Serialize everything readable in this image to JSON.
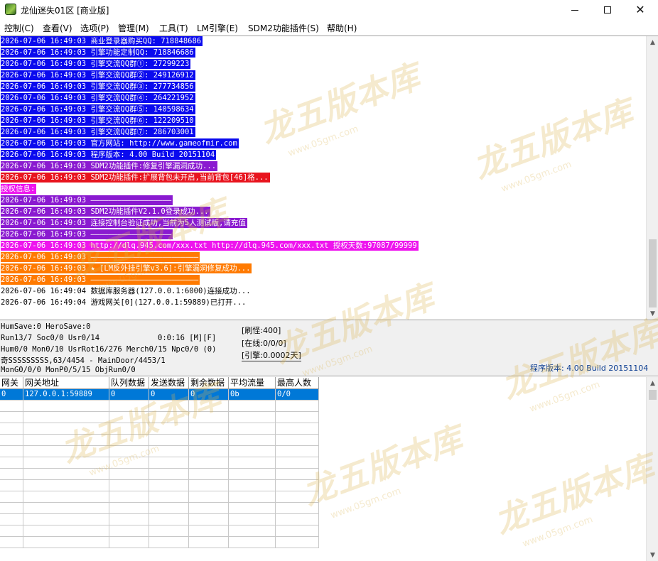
{
  "window": {
    "title": "龙仙迷失01区 [商业版]",
    "icon": "game-app-icon",
    "minimize_glyph": "",
    "close_glyph": "✕"
  },
  "menu": [
    "控制(C)",
    "查看(V)",
    "选项(P)",
    "管理(M)",
    "工具(T)",
    "LM引擎(E)",
    "SDM2功能插件(S)",
    "帮助(H)"
  ],
  "log": {
    "lines": [
      {
        "time": "2026-07-06 16:49:03",
        "text": "商业登录器购买QQ: 718848686",
        "bg": "#0a0aee",
        "fg": "#ffffff"
      },
      {
        "time": "2026-07-06 16:49:03",
        "text": "引擎功能定制QQ: 718846686",
        "bg": "#0a0aee",
        "fg": "#ffffff"
      },
      {
        "time": "2026-07-06 16:49:03",
        "text": "引擎交流QQ群①: 27299223",
        "bg": "#0a0aee",
        "fg": "#ffffff"
      },
      {
        "time": "2026-07-06 16:49:03",
        "text": "引擎交流QQ群②: 249126912",
        "bg": "#0a0aee",
        "fg": "#ffffff"
      },
      {
        "time": "2026-07-06 16:49:03",
        "text": "引擎交流QQ群③: 277734856",
        "bg": "#0a0aee",
        "fg": "#ffffff"
      },
      {
        "time": "2026-07-06 16:49:03",
        "text": "引擎交流QQ群④: 264221952",
        "bg": "#0a0aee",
        "fg": "#ffffff"
      },
      {
        "time": "2026-07-06 16:49:03",
        "text": "引擎交流QQ群⑤: 140598634",
        "bg": "#0a0aee",
        "fg": "#ffffff"
      },
      {
        "time": "2026-07-06 16:49:03",
        "text": "引擎交流QQ群⑥: 122209510",
        "bg": "#0a0aee",
        "fg": "#ffffff"
      },
      {
        "time": "2026-07-06 16:49:03",
        "text": "引擎交流QQ群⑦: 286703001",
        "bg": "#0a0aee",
        "fg": "#ffffff"
      },
      {
        "time": "2026-07-06 16:49:03",
        "text": "官方网站: http://www.gameofmir.com",
        "bg": "#0a0aee",
        "fg": "#ffffff"
      },
      {
        "time": "2026-07-06 16:49:03",
        "text": "程序版本: 4.00 Build 20151104",
        "bg": "#0a0aee",
        "fg": "#ffffff"
      },
      {
        "time": "2026-07-06 16:49:03",
        "text": "SDM2功能插件:修复引擎漏洞成功...",
        "bg": "#8a1ad0",
        "fg": "#ffffff"
      },
      {
        "time": "2026-07-06 16:49:03",
        "text": "SDM2功能插件:扩展背包未开启,当前背包[46]格...",
        "bg": "#e8141e",
        "fg": "#ffffff"
      },
      {
        "time": "",
        "text": "授权信息:",
        "bg": "#ee14ee",
        "fg": "#ffffff"
      },
      {
        "time": "2026-07-06 16:49:03",
        "text": "——————————————————",
        "bg": "#8a1ad0",
        "fg": "#ffffff"
      },
      {
        "time": "2026-07-06 16:49:03",
        "text": "SDM2功能插件V2.1.0登录成功...",
        "bg": "#8a1ad0",
        "fg": "#ffffff"
      },
      {
        "time": "2026-07-06 16:49:03",
        "text": "连接控制台验证成功,当前为5人测试版,请充值",
        "bg": "#8a1ad0",
        "fg": "#ffffff"
      },
      {
        "time": "2026-07-06 16:49:03",
        "text": "——————————————————",
        "bg": "#8a1ad0",
        "fg": "#ffffff"
      },
      {
        "time": "2026-07-06 16:49:03",
        "text": "http://dlq.945.com/xxx.txt http://dlq.945.com/xxx.txt 授权天数:97087/99999",
        "bg": "#ee14ee",
        "fg": "#ffffff"
      },
      {
        "time": "2026-07-06 16:49:03",
        "text": "————————————————————————",
        "bg": "#ff7a00",
        "fg": "#ffffff"
      },
      {
        "time": "2026-07-06 16:49:03",
        "text": "★ [LM反外挂引擎v3.6]:引擎漏洞修复成功...",
        "bg": "#ff7a00",
        "fg": "#ffffff"
      },
      {
        "time": "2026-07-06 16:49:03",
        "text": "————————————————————————",
        "bg": "#ff7a00",
        "fg": "#ffffff"
      },
      {
        "time": "2026-07-06 16:49:04",
        "text": "数据库服务器(127.0.0.1:6000)连接成功...",
        "bg": "#ffffff",
        "fg": "#000000"
      },
      {
        "time": "2026-07-06 16:49:04",
        "text": "游戏网关[0](127.0.0.1:59889)已打开...",
        "bg": "#ffffff",
        "fg": "#000000"
      }
    ]
  },
  "status": {
    "line1": "HumSave:0 HeroSave:0",
    "line2": "Run13/7 Soc0/0 Usr0/14",
    "timer": "0:0:16 [M][F]",
    "line3": "Hum0/0 Mon0/10 UsrRot16/276 Merch0/15 Npc0/0 (0)",
    "line4": "奇SSSSSSSSS,63/4454 - MainDoor/4453/1",
    "line5": "MonG0/0/0 MonP0/5/15 ObjRun0/0",
    "refresh": "[刷怪:400]",
    "online": "[在线:0/0/0]",
    "engine": "[引擎:0.0002天]",
    "version": "程序版本: 4.00 Build 20151104"
  },
  "grid": {
    "headers": [
      "网关",
      "网关地址",
      "队列数据",
      "发送数据",
      "剩余数据",
      "平均流量",
      "最高人数"
    ],
    "rows": [
      [
        "0",
        "127.0.0.1:59889",
        "0",
        "0",
        "0",
        "0b",
        "0/0"
      ]
    ],
    "selection_color": "#0078d7"
  },
  "watermark": {
    "text": "龙五版本库",
    "sub": "www.05gm.com"
  }
}
